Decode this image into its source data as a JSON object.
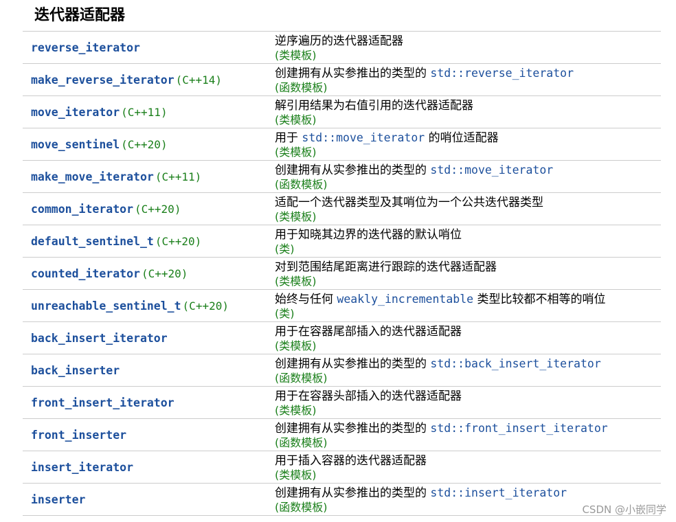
{
  "heading": "迭代器适配器",
  "rows": [
    {
      "name": "reverse_iterator",
      "ver": "",
      "desc_pre": "逆序遍历的迭代器适配器",
      "desc_code": "",
      "desc_post": "",
      "kind": "(类模板)"
    },
    {
      "name": "make_reverse_iterator",
      "ver": "(C++14)",
      "desc_pre": "创建拥有从实参推出的类型的 ",
      "desc_code": "std::reverse_iterator",
      "desc_post": "",
      "kind": "(函数模板)"
    },
    {
      "name": "move_iterator",
      "ver": "(C++11)",
      "desc_pre": "解引用结果为右值引用的迭代器适配器",
      "desc_code": "",
      "desc_post": "",
      "kind": "(类模板)"
    },
    {
      "name": "move_sentinel",
      "ver": "(C++20)",
      "desc_pre": "用于 ",
      "desc_code": "std::move_iterator",
      "desc_post": " 的哨位适配器",
      "kind": "(类模板)"
    },
    {
      "name": "make_move_iterator",
      "ver": "(C++11)",
      "desc_pre": "创建拥有从实参推出的类型的 ",
      "desc_code": "std::move_iterator",
      "desc_post": "",
      "kind": "(函数模板)"
    },
    {
      "name": "common_iterator",
      "ver": "(C++20)",
      "desc_pre": "适配一个迭代器类型及其哨位为一个公共迭代器类型",
      "desc_code": "",
      "desc_post": "",
      "kind": "(类模板)"
    },
    {
      "name": "default_sentinel_t",
      "ver": "(C++20)",
      "desc_pre": "用于知晓其边界的迭代器的默认哨位",
      "desc_code": "",
      "desc_post": "",
      "kind": "(类)"
    },
    {
      "name": "counted_iterator",
      "ver": "(C++20)",
      "desc_pre": "对到范围结尾距离进行跟踪的迭代器适配器",
      "desc_code": "",
      "desc_post": "",
      "kind": "(类模板)"
    },
    {
      "name": "unreachable_sentinel_t",
      "ver": "(C++20)",
      "desc_pre": "始终与任何 ",
      "desc_code": "weakly_incrementable",
      "desc_post": " 类型比较都不相等的哨位",
      "kind": "(类)"
    },
    {
      "name": "back_insert_iterator",
      "ver": "",
      "desc_pre": "用于在容器尾部插入的迭代器适配器",
      "desc_code": "",
      "desc_post": "",
      "kind": "(类模板)"
    },
    {
      "name": "back_inserter",
      "ver": "",
      "desc_pre": "创建拥有从实参推出的类型的 ",
      "desc_code": "std::back_insert_iterator",
      "desc_post": "",
      "kind": "(函数模板)"
    },
    {
      "name": "front_insert_iterator",
      "ver": "",
      "desc_pre": "用于在容器头部插入的迭代器适配器",
      "desc_code": "",
      "desc_post": "",
      "kind": "(类模板)"
    },
    {
      "name": "front_inserter",
      "ver": "",
      "desc_pre": "创建拥有从实参推出的类型的 ",
      "desc_code": "std::front_insert_iterator",
      "desc_post": "",
      "kind": "(函数模板)"
    },
    {
      "name": "insert_iterator",
      "ver": "",
      "desc_pre": "用于插入容器的迭代器适配器",
      "desc_code": "",
      "desc_post": "",
      "kind": "(类模板)"
    },
    {
      "name": "inserter",
      "ver": "",
      "desc_pre": "创建拥有从实参推出的类型的 ",
      "desc_code": "std::insert_iterator",
      "desc_post": "",
      "kind": "(函数模板)"
    }
  ],
  "watermark": "CSDN @小嵌同学"
}
